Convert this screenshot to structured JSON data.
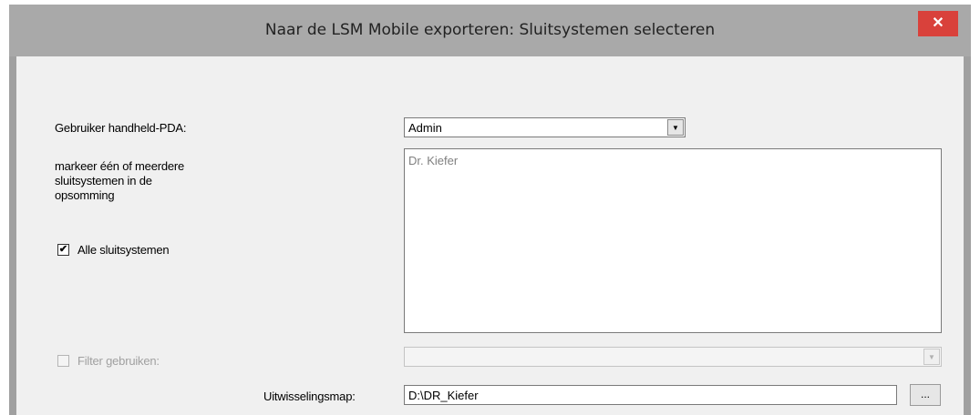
{
  "window": {
    "title": "Naar de LSM Mobile exporteren: Sluitsystemen selecteren",
    "close_glyph": "✕",
    "close_color": "#d9413b"
  },
  "form": {
    "user_label": "Gebruiker handheld-PDA:",
    "user_selected": "Admin",
    "instruction_line1": "markeer één of meerdere",
    "instruction_line2": "sluitsystemen in de",
    "instruction_line3": "opsomming",
    "all_systems_label": "Alle sluitsystemen",
    "all_systems_checked": true,
    "locking_systems": [
      "Dr. Kiefer"
    ],
    "filter_label": "Filter gebruiken:",
    "filter_checked": false,
    "filter_enabled": false,
    "filter_selected": "",
    "exchange_label": "Uitwisselingsmap:",
    "exchange_path": "D:\\DR_Kiefer",
    "browse_label": "..."
  },
  "icons": {
    "check": "✔",
    "dropdown": "▼"
  }
}
